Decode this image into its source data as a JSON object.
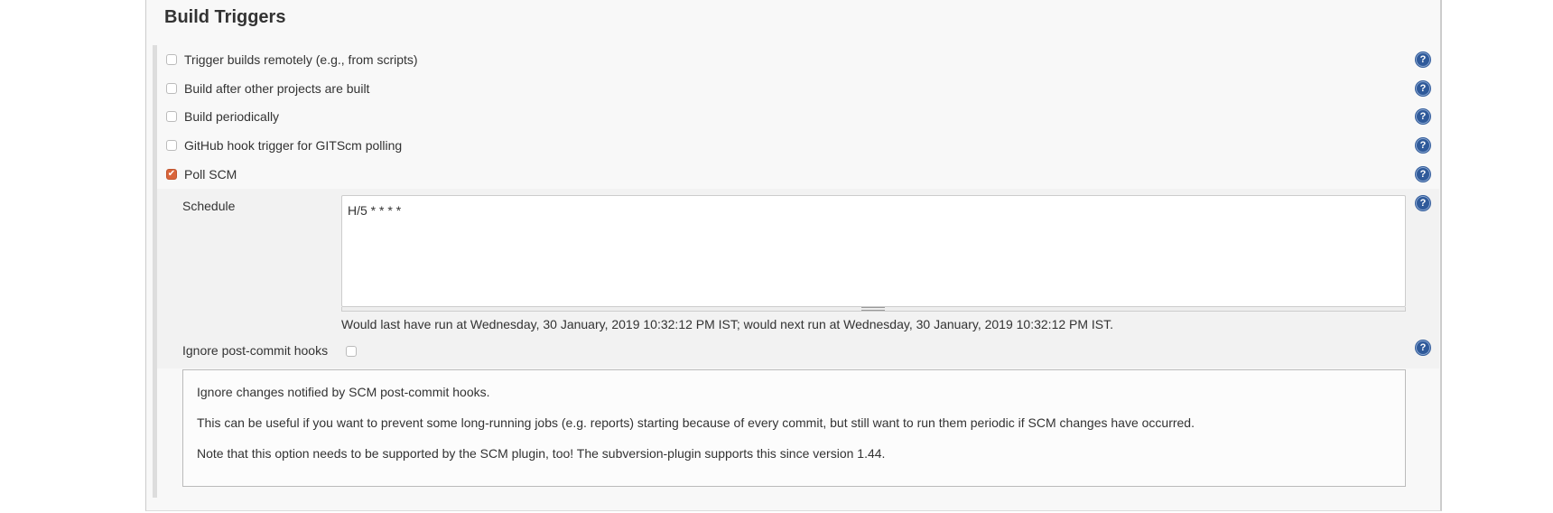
{
  "section": {
    "title": "Build Triggers"
  },
  "triggers": [
    {
      "label": "Trigger builds remotely (e.g., from scripts)",
      "checked": false
    },
    {
      "label": "Build after other projects are built",
      "checked": false
    },
    {
      "label": "Build periodically",
      "checked": false
    },
    {
      "label": "GitHub hook trigger for GITScm polling",
      "checked": false
    },
    {
      "label": "Poll SCM",
      "checked": true
    }
  ],
  "poll_scm": {
    "schedule_label": "Schedule",
    "schedule_value": "H/5 * * * *",
    "schedule_info": "Would last have run at Wednesday, 30 January, 2019 10:32:12 PM IST; would next run at Wednesday, 30 January, 2019 10:32:12 PM IST.",
    "ignore_hooks_label": "Ignore post-commit hooks",
    "ignore_hooks_checked": false,
    "help_text": [
      "Ignore changes notified by SCM post-commit hooks.",
      "This can be useful if you want to prevent some long-running jobs (e.g. reports) starting because of every commit, but still want to run them periodic if SCM changes have occurred.",
      "Note that this option needs to be supported by the SCM plugin, too! The subversion-plugin supports this since version 1.44."
    ]
  },
  "icons": {
    "help": "help-icon",
    "help_glyph": "?",
    "check_glyph": "✔"
  },
  "colors": {
    "help": "#2f5a9a",
    "checked": "#d9643a"
  }
}
